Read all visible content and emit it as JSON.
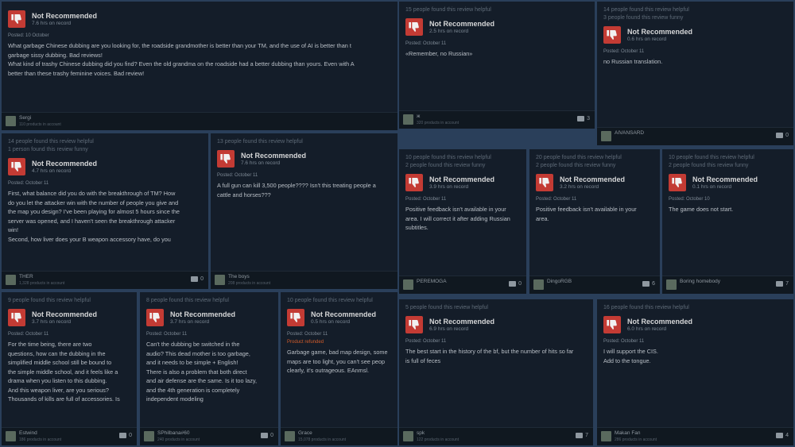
{
  "recommendation": "Not Recommended",
  "colors": {
    "thumb_bg": "#c33b34",
    "award": "#67c1f5",
    "refund": "#d35c2a"
  },
  "icons": {
    "thumb": "thumbs-down-icon",
    "award": "award-icon",
    "comment": "comment-bubble-icon"
  },
  "reviews": [
    {
      "helpful": "",
      "funny": "",
      "awards": "",
      "hours": "7.6 hrs on record",
      "posted": "Posted: 10 October",
      "text": "What garbage Chinese dubbing are you looking for, the roadside grandmother is better than your TM, and the use of AI is better than t\ngarbage sissy dubbing. Bad reviews!\nWhat kind of trashy Chinese dubbing did you find? Even the old grandma on the roadside had a better dubbing than yours. Even with A\nbetter than these trashy feminine voices. Bad review!",
      "user": "Sergi",
      "products": "110 products in account",
      "comments": ""
    },
    {
      "helpful": "15 people found this review helpful",
      "funny": "",
      "awards": "0",
      "hours": "2.5 hrs on record",
      "posted": "Posted: October 11",
      "text": "«Remember, no Russian»",
      "user": "ж",
      "products": "320 products in account",
      "comments": "3"
    },
    {
      "helpful": "14 people found this review helpful",
      "funny": "3 people found this review funny",
      "awards": "0",
      "hours": "0.6 hrs on record",
      "posted": "Posted: October 11",
      "text": "no Russian translation.",
      "user": "AIVANSARD",
      "products": "",
      "comments": "0"
    },
    {
      "helpful": "14 people found this review helpful",
      "funny": "1 person found this review funny",
      "awards": "0",
      "hours": "4.7 hrs on record",
      "posted": "Posted: October 11",
      "text": "First, what balance did you do with the breakthrough of TM? How\ndo you let the attacker win with the number of people you give and\nthe map you design? I've been playing for almost 5 hours since the\nserver was opened, and I haven't seen the breakthrough attacker\nwin!\nSecond, how liver does your B weapon accessory have, do you",
      "user": "THER",
      "products": "1,328 products in account",
      "comments": "0"
    },
    {
      "helpful": "13 people found this review helpful",
      "funny": "",
      "awards": "0",
      "hours": "7.6 hrs on record",
      "posted": "Posted: October 11",
      "text": "A full gun can kill 3,500 people???? Isn't this treating people a\ncattle and horses???",
      "user": "The boys",
      "products": "208 products in account",
      "comments": ""
    },
    {
      "helpful": "10 people found this review helpful",
      "funny": "2 people found this review funny",
      "awards": "0",
      "hours": "3.9 hrs on record",
      "posted": "Posted: October 11",
      "text": "Positive feedback isn't available in your\narea. I will correct it after adding Russian\nsubtitles.",
      "user": "PEREMOGA",
      "products": "",
      "comments": "0"
    },
    {
      "helpful": "20 people found this review helpful",
      "funny": "2 people found this review funny",
      "awards": "0",
      "hours": "3.2 hrs on record",
      "posted": "Posted: October 11",
      "text": "Positive feedback isn't available in your\narea.",
      "user": "DingoRGB",
      "products": "",
      "comments": "6"
    },
    {
      "helpful": "10 people found this review helpful",
      "funny": "2 people found this review funny",
      "awards": "0",
      "hours": "0.1 hrs on record",
      "posted": "Posted: October 10",
      "text": "The game does not start.",
      "user": "Boring homebody",
      "products": "",
      "comments": "7"
    },
    {
      "helpful": "9 people found this review helpful",
      "funny": "",
      "awards": "0",
      "hours": "3.7 hrs on record",
      "posted": "Posted: October 11",
      "text": "For the time being, there are two\nquestions, how can the dubbing in the\nsimplified middle school still be bound to\nthe simple middle school, and it feels like a\ndrama when you listen to this dubbing.\nAnd this weapon liver, are you serious?\nThousands of kills are full of accessories. Is",
      "user": "Estwind",
      "products": "186 products in account",
      "comments": "0"
    },
    {
      "helpful": "8 people found this review helpful",
      "funny": "",
      "awards": "0",
      "hours": "3.7 hrs on record",
      "posted": "Posted: October 11",
      "text": "Can't the dubbing be switched in the\naudio? This dead mother is too garbage,\nand it needs to be simple + English!\nThere is also a problem that both direct\nand air defense are the same. Is it too lazy,\nand the 4th generation is completely\nindependent modeling",
      "user": "SPhilbana#60",
      "products": "240 products in account",
      "comments": "0"
    },
    {
      "helpful": "10 people found this review helpful",
      "funny": "",
      "awards": "0",
      "hours": "0.5 hrs on record",
      "posted": "Posted: October 11",
      "refund": "Product refunded",
      "text": "Garbage game, bad map design, some\nmaps are too light, you can't see peop\nclearly, it's outrageous. EAnmsl.",
      "user": "Grace",
      "products": "15,078 products in account",
      "comments": ""
    },
    {
      "helpful": "5 people found this review helpful",
      "funny": "",
      "awards": "2",
      "hours": "6.9 hrs on record",
      "posted": "Posted: October 11",
      "text": "The best start in the history of the bf, but the number of hits so far\nis full of feces",
      "user": "spk",
      "products": "122 products in account",
      "comments": "7"
    },
    {
      "helpful": "16 people found this review helpful",
      "funny": "",
      "awards": "1",
      "hours": "6.0 hrs on record",
      "posted": "Posted: October 11",
      "text": "I will support the CIS.\nAdd to the tongue.",
      "user": "Makan Fan",
      "products": "286 products in account",
      "comments": "4"
    }
  ]
}
